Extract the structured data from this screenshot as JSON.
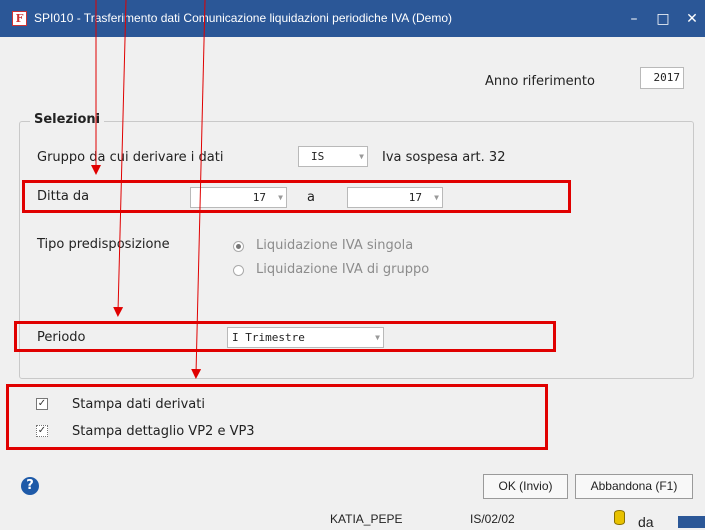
{
  "window": {
    "title": "SPI010 - Trasferimento dati Comunicazione liquidazioni periodiche IVA (Demo)",
    "icon": "F",
    "minimize": "–",
    "maximize": "□",
    "close": "✕"
  },
  "anno": {
    "label": "Anno riferimento",
    "value": "2017"
  },
  "selezioni": {
    "legend": "Selezioni",
    "gruppo": {
      "label": "Gruppo da cui derivare i dati",
      "value": "IS",
      "description": "Iva sospesa art. 32"
    },
    "ditta": {
      "label": "Ditta da",
      "from": "17",
      "sep": "a",
      "to": "17"
    },
    "tipo": {
      "label": "Tipo predisposizione",
      "options": [
        {
          "label": "Liquidazione IVA singola",
          "selected": true
        },
        {
          "label": "Liquidazione IVA di gruppo",
          "selected": false
        }
      ]
    },
    "periodo": {
      "label": "Periodo",
      "value": "I Trimestre"
    }
  },
  "checks": [
    {
      "label": "Stampa dati derivati",
      "checked": true,
      "mark": "✓"
    },
    {
      "label": "Stampa dettaglio VP2 e VP3",
      "checked": true,
      "mark": "✓"
    }
  ],
  "buttons": {
    "ok": "OK (Invio)",
    "cancel": "Abbandona (F1)"
  },
  "help": "?",
  "status": {
    "user": "KATIA_PEPE",
    "code": "IS/02/02",
    "extra": "da"
  },
  "dropdown_glyph": "▼",
  "colors": {
    "titlebar": "#2b5797",
    "annotation": "#e00000"
  }
}
